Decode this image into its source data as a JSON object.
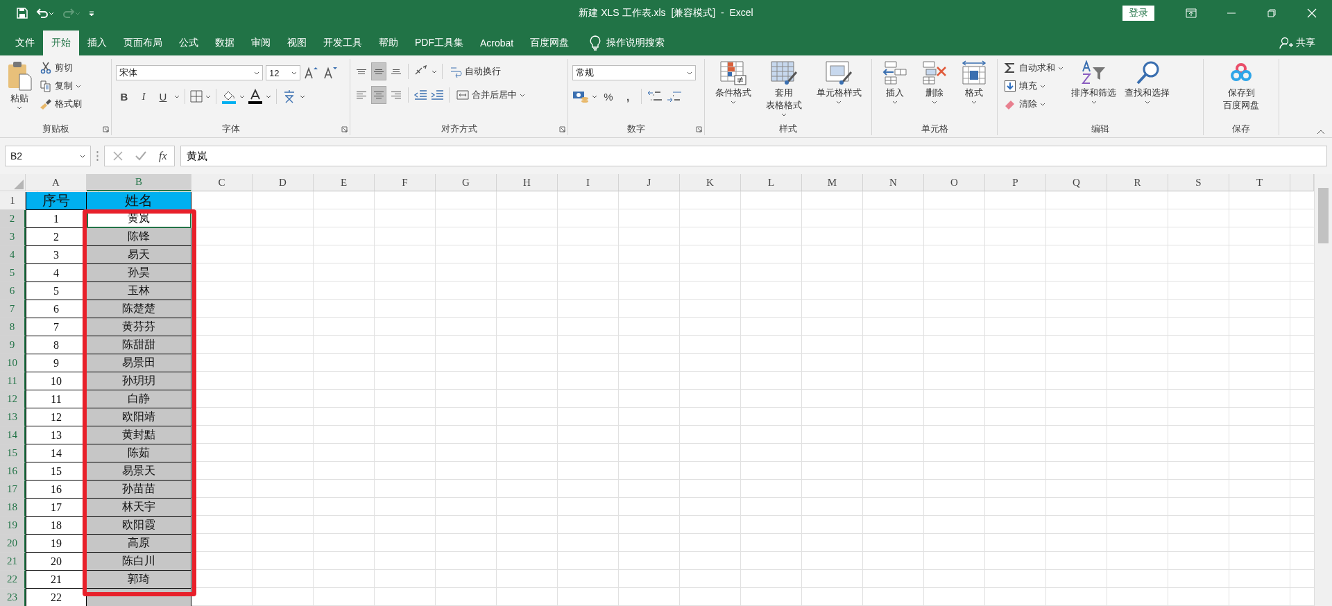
{
  "title_bar": {
    "title": "新建 XLS 工作表.xls  [兼容模式]  -  Excel",
    "login": "登录"
  },
  "tabs": [
    {
      "label": "文件",
      "selected": false
    },
    {
      "label": "开始",
      "selected": true
    },
    {
      "label": "插入",
      "selected": false
    },
    {
      "label": "页面布局",
      "selected": false
    },
    {
      "label": "公式",
      "selected": false
    },
    {
      "label": "数据",
      "selected": false
    },
    {
      "label": "审阅",
      "selected": false
    },
    {
      "label": "视图",
      "selected": false
    },
    {
      "label": "开发工具",
      "selected": false
    },
    {
      "label": "帮助",
      "selected": false
    },
    {
      "label": "PDF工具集",
      "selected": false
    },
    {
      "label": "Acrobat",
      "selected": false
    },
    {
      "label": "百度网盘",
      "selected": false
    }
  ],
  "tell_me": "操作说明搜索",
  "share": "共享",
  "ribbon": {
    "clipboard": {
      "label": "剪贴板",
      "paste": "粘贴",
      "items": [
        {
          "kind": "cut",
          "label": "剪切"
        },
        {
          "kind": "copy",
          "label": "复制"
        },
        {
          "kind": "brush",
          "label": "格式刷"
        }
      ]
    },
    "font": {
      "label": "字体",
      "font_name": "宋体",
      "font_size": "12",
      "styles": [
        "B",
        "I",
        "U"
      ]
    },
    "alignment": {
      "label": "对齐方式",
      "vertical": [
        {
          "kind": "top",
          "selected": false
        },
        {
          "kind": "middle",
          "selected": true
        },
        {
          "kind": "bottom",
          "selected": false
        }
      ],
      "horizontal": [
        {
          "kind": "left",
          "selected": false
        },
        {
          "kind": "center",
          "selected": true
        },
        {
          "kind": "right",
          "selected": false
        }
      ],
      "wrap": "自动换行",
      "merge": "合并后居中"
    },
    "number": {
      "label": "数字",
      "format": "常规",
      "percent": "%",
      "comma": ","
    },
    "styles": {
      "label": "样式",
      "buttons": [
        {
          "kind": "conditional",
          "label": "条件格式"
        },
        {
          "kind": "table",
          "label": "套用",
          "label_2": "表格格式"
        },
        {
          "kind": "cellstyle",
          "label": "单元格样式"
        }
      ]
    },
    "cells": {
      "label": "单元格",
      "buttons": [
        {
          "kind": "insert",
          "label": "插入"
        },
        {
          "kind": "delete",
          "label": "删除"
        },
        {
          "kind": "format",
          "label": "格式"
        }
      ]
    },
    "editing": {
      "label": "编辑",
      "items": [
        {
          "kind": "sum",
          "label": "自动求和"
        },
        {
          "kind": "fill",
          "label": "填充"
        },
        {
          "kind": "clear",
          "label": "清除"
        }
      ],
      "buttons": [
        {
          "kind": "sort",
          "label": "排序和筛选"
        },
        {
          "kind": "find",
          "label": "查找和选择"
        }
      ]
    },
    "save": {
      "label": "保存",
      "button": "保存到",
      "button_2": "百度网盘"
    }
  },
  "formula_bar": {
    "name_box": "B2",
    "fx": "fx",
    "value": "黄岚"
  },
  "sheet": {
    "columns": [
      {
        "label": "A",
        "selected": false
      },
      {
        "label": "B",
        "selected": true
      },
      {
        "label": "C",
        "selected": false
      },
      {
        "label": "D",
        "selected": false
      },
      {
        "label": "E",
        "selected": false
      },
      {
        "label": "F",
        "selected": false
      },
      {
        "label": "G",
        "selected": false
      },
      {
        "label": "H",
        "selected": false
      },
      {
        "label": "I",
        "selected": false
      },
      {
        "label": "J",
        "selected": false
      },
      {
        "label": "K",
        "selected": false
      },
      {
        "label": "L",
        "selected": false
      },
      {
        "label": "M",
        "selected": false
      },
      {
        "label": "N",
        "selected": false
      },
      {
        "label": "O",
        "selected": false
      },
      {
        "label": "P",
        "selected": false
      },
      {
        "label": "Q",
        "selected": false
      },
      {
        "label": "R",
        "selected": false
      },
      {
        "label": "S",
        "selected": false
      },
      {
        "label": "T",
        "selected": false
      }
    ],
    "rows": [
      {
        "header": "1",
        "selected": false,
        "active": false,
        "cells": [
          "序号",
          "姓名"
        ]
      },
      {
        "header": "2",
        "selected": true,
        "active": true,
        "cells": [
          "1",
          "黄岚"
        ]
      },
      {
        "header": "3",
        "selected": true,
        "active": false,
        "cells": [
          "2",
          "陈锋"
        ]
      },
      {
        "header": "4",
        "selected": true,
        "active": false,
        "cells": [
          "3",
          "易天"
        ]
      },
      {
        "header": "5",
        "selected": true,
        "active": false,
        "cells": [
          "4",
          "孙昊"
        ]
      },
      {
        "header": "6",
        "selected": true,
        "active": false,
        "cells": [
          "5",
          "玉林"
        ]
      },
      {
        "header": "7",
        "selected": true,
        "active": false,
        "cells": [
          "6",
          "陈楚楚"
        ]
      },
      {
        "header": "8",
        "selected": true,
        "active": false,
        "cells": [
          "7",
          "黄芬芬"
        ]
      },
      {
        "header": "9",
        "selected": true,
        "active": false,
        "cells": [
          "8",
          "陈甜甜"
        ]
      },
      {
        "header": "10",
        "selected": true,
        "active": false,
        "cells": [
          "9",
          "易景田"
        ]
      },
      {
        "header": "11",
        "selected": true,
        "active": false,
        "cells": [
          "10",
          "孙玥玥"
        ]
      },
      {
        "header": "12",
        "selected": true,
        "active": false,
        "cells": [
          "11",
          "白静"
        ]
      },
      {
        "header": "13",
        "selected": true,
        "active": false,
        "cells": [
          "12",
          "欧阳靖"
        ]
      },
      {
        "header": "14",
        "selected": true,
        "active": false,
        "cells": [
          "13",
          "黄封黠"
        ]
      },
      {
        "header": "15",
        "selected": true,
        "active": false,
        "cells": [
          "14",
          "陈茹"
        ]
      },
      {
        "header": "16",
        "selected": true,
        "active": false,
        "cells": [
          "15",
          "易景天"
        ]
      },
      {
        "header": "17",
        "selected": true,
        "active": false,
        "cells": [
          "16",
          "孙苗苗"
        ]
      },
      {
        "header": "18",
        "selected": true,
        "active": false,
        "cells": [
          "17",
          "林天宇"
        ]
      },
      {
        "header": "19",
        "selected": true,
        "active": false,
        "cells": [
          "18",
          "欧阳霞"
        ]
      },
      {
        "header": "20",
        "selected": true,
        "active": false,
        "cells": [
          "19",
          "高原"
        ]
      },
      {
        "header": "21",
        "selected": true,
        "active": false,
        "cells": [
          "20",
          "陈白川"
        ]
      },
      {
        "header": "22",
        "selected": true,
        "active": false,
        "cells": [
          "21",
          "郭琦"
        ]
      },
      {
        "header": "23",
        "selected": true,
        "active": false,
        "cells": [
          "22"
        ]
      }
    ]
  }
}
